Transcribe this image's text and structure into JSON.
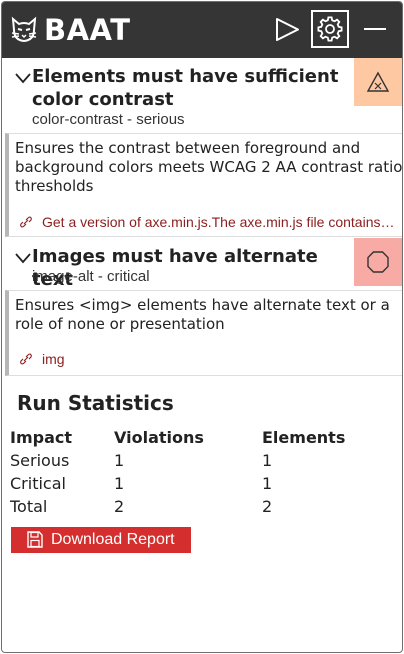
{
  "app": {
    "title": "BAAT"
  },
  "header": {
    "logo_icon": "cat-logo-icon",
    "buttons": [
      {
        "name": "run-button",
        "icon": "play-icon"
      },
      {
        "name": "settings-button",
        "icon": "gear-icon",
        "active": true
      },
      {
        "name": "minimize-button",
        "icon": "minus-icon"
      }
    ]
  },
  "rules": [
    {
      "title": "Elements must have sufficient color contrast",
      "subtitle": "color-contrast - serious",
      "impact": "serious",
      "impact_icon": "warning-triangle-icon",
      "description": "Ensures the contrast between foreground and background colors meets WCAG 2 AA contrast ratio thresholds",
      "nodes": [
        "Get a version of axe.min.js.The axe.min.js file contains all of the rules"
      ]
    },
    {
      "title": "Images must have alternate text",
      "subtitle": "image-alt - critical",
      "impact": "critical",
      "impact_icon": "octagon-icon",
      "description": "Ensures <img> elements have alternate text or a role of none or presentation",
      "nodes": [
        "img"
      ]
    }
  ],
  "stats": {
    "title": "Run Statistics",
    "columns": [
      "Impact",
      "Violations",
      "Elements"
    ],
    "rows": [
      [
        "Serious",
        "1",
        "1"
      ],
      [
        "Critical",
        "1",
        "1"
      ],
      [
        "Total",
        "2",
        "2"
      ]
    ]
  },
  "download": {
    "label": "Download Report",
    "icon": "save-icon"
  },
  "colors": {
    "header_bg": "#353535",
    "serious": "#fdc8a2",
    "critical": "#f8aaa5",
    "accent": "#d42e2e",
    "link": "#8b1e1e"
  }
}
